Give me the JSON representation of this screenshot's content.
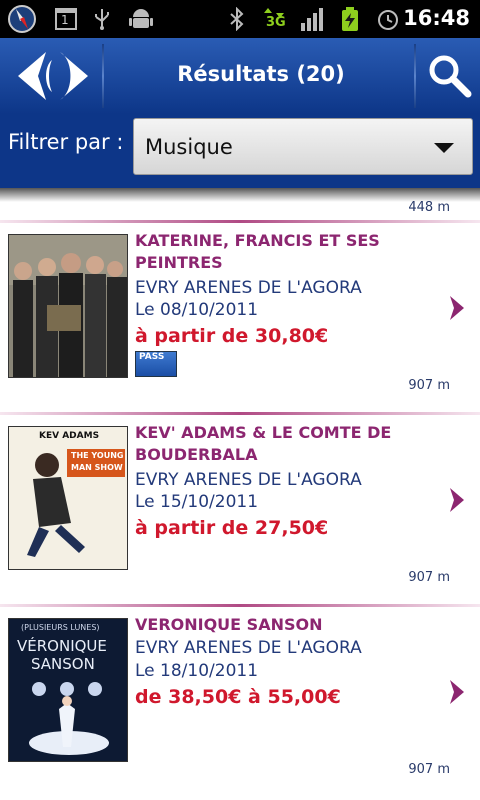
{
  "status_bar": {
    "time": "16:48",
    "network": "3G",
    "notification_count": "1"
  },
  "header": {
    "title": "Résultats (20)"
  },
  "filter": {
    "label": "Filtrer par :",
    "selected": "Musique"
  },
  "list": {
    "top_distance": "448 m",
    "items": [
      {
        "name": "KATERINE, FRANCIS ET SES PEINTRES",
        "venue": "EVRY ARENES DE L'AGORA",
        "date": "Le 08/10/2011",
        "price": "à partir de 30,80€",
        "badge": "PASS",
        "distance": "907 m"
      },
      {
        "name": "KEV' ADAMS & LE COMTE DE BOUDERBALA",
        "venue": "EVRY ARENES DE L'AGORA",
        "date": "Le 15/10/2011",
        "price": "à partir de 27,50€",
        "poster": {
          "line1": "KEV ADAMS",
          "line2": "THE YOUNG",
          "line3": "MAN SHOW"
        },
        "distance": "907 m"
      },
      {
        "name": "VERONIQUE SANSON",
        "venue": "EVRY ARENES DE L'AGORA",
        "date": "Le 18/10/2011",
        "price": "de 38,50€ à 55,00€",
        "poster": {
          "line1": "(PLUSIEURS LUNES)",
          "line2": "VÉRONIQUE",
          "line3": "SANSON"
        },
        "distance": "907 m"
      }
    ]
  }
}
